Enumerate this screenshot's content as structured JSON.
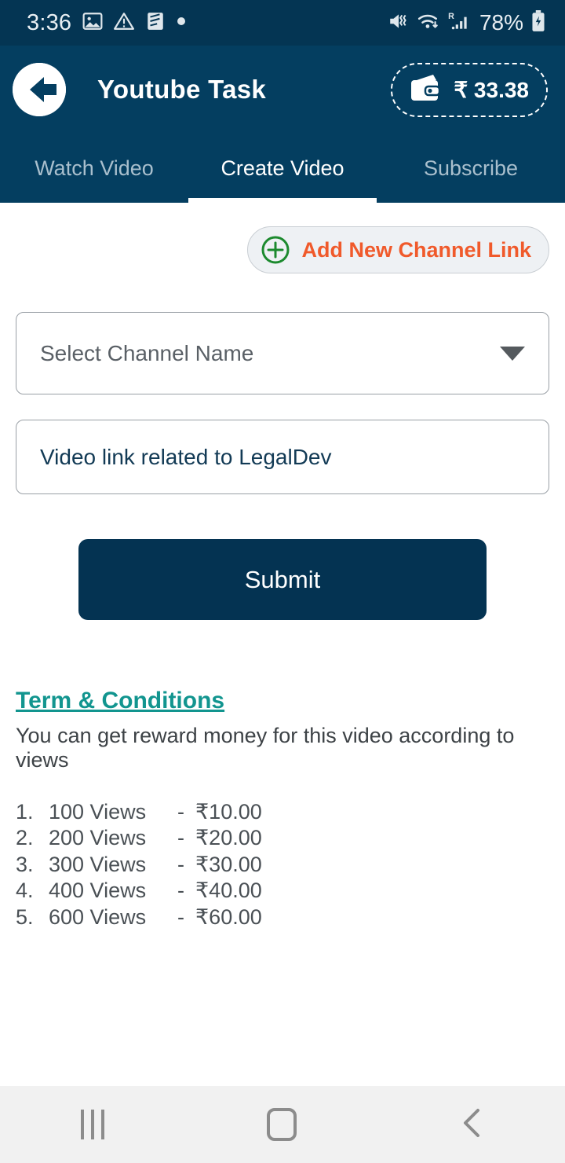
{
  "status_bar": {
    "time": "3:36",
    "left_icons": [
      "image-icon",
      "warning-icon",
      "note-icon",
      "dot-icon"
    ],
    "battery_percent": "78%",
    "right_icons": [
      "mute-vibrate-icon",
      "wifi-icon",
      "roaming-signal-icon",
      "battery-charging-icon"
    ]
  },
  "app_bar": {
    "back_icon": "back-arrow-circle-icon",
    "title": "Youtube Task",
    "wallet": {
      "icon": "wallet-icon",
      "amount": "₹ 33.38"
    }
  },
  "tabs": [
    {
      "label": "Watch Video",
      "active": false
    },
    {
      "label": "Create Video",
      "active": true
    },
    {
      "label": "Subscribe",
      "active": false
    }
  ],
  "main": {
    "add_channel_button": {
      "label": "Add New Channel Link",
      "icon": "plus-circle-icon"
    },
    "channel_select": {
      "value": "Select Channel Name",
      "caret": "chevron-down-icon"
    },
    "video_link_input": {
      "placeholder": "Video link related to LegalDev",
      "value": ""
    },
    "submit_label": "Submit",
    "terms": {
      "heading": "Term & Conditions",
      "description": "You can get reward money for this video according to views",
      "rewards": [
        {
          "num": "1.",
          "views": "100 Views",
          "dash": "-",
          "amount": "₹10.00"
        },
        {
          "num": "2.",
          "views": "200 Views",
          "dash": "-",
          "amount": "₹20.00"
        },
        {
          "num": "3.",
          "views": "300 Views",
          "dash": "-",
          "amount": "₹30.00"
        },
        {
          "num": "4.",
          "views": "400 Views",
          "dash": "-",
          "amount": "₹40.00"
        },
        {
          "num": "5.",
          "views": "600 Views",
          "dash": "-",
          "amount": "₹60.00"
        }
      ]
    }
  },
  "nav_bar": {
    "recents": "recents-icon",
    "home": "home-icon",
    "back": "back-icon"
  },
  "colors": {
    "header_navy": "#043e60",
    "status_navy": "#043553",
    "accent_orange": "#f05a2b",
    "accent_green": "#1c8a2e",
    "teal_link": "#12958f",
    "submit_navy": "#043352"
  }
}
